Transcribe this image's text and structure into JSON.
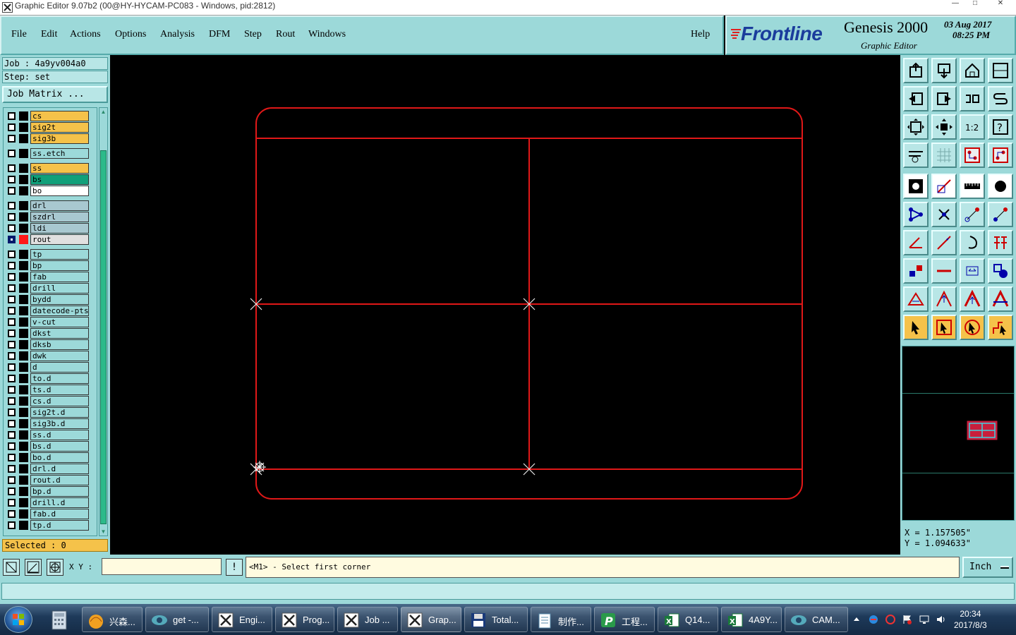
{
  "window": {
    "title": "Graphic Editor 9.07b2 (00@HY-HYCAM-PC083 - Windows, pid:2812)",
    "controls": [
      "—",
      "□",
      "✕"
    ]
  },
  "menu": [
    {
      "label": "File",
      "name": "menu-file"
    },
    {
      "label": "Edit",
      "name": "menu-edit"
    },
    {
      "label": "Actions",
      "name": "menu-actions"
    },
    {
      "label": "Options",
      "name": "menu-options"
    },
    {
      "label": "Analysis",
      "name": "menu-analysis"
    },
    {
      "label": "DFM",
      "name": "menu-dfm"
    },
    {
      "label": "Step",
      "name": "menu-step"
    },
    {
      "label": "Rout",
      "name": "menu-rout"
    },
    {
      "label": "Windows",
      "name": "menu-windows"
    },
    {
      "label": "Help",
      "name": "menu-help"
    }
  ],
  "logo": {
    "brand": "Frontline",
    "product": "Genesis 2000",
    "subtitle": "Graphic Editor",
    "date": "03 Aug 2017",
    "time": "08:25 PM"
  },
  "job": {
    "job_label": "Job : 4a9yv004a0",
    "step_label": "Step: set",
    "matrix_button": "Job Matrix ..."
  },
  "layers": [
    {
      "name": "cs",
      "bg": "#f5c24a",
      "active": false
    },
    {
      "name": "sig2t",
      "bg": "#f5c24a",
      "active": false
    },
    {
      "name": "sig3b",
      "bg": "#f5c24a",
      "active": false
    },
    {
      "name": "ss.etch",
      "bg": "#9cd9d9",
      "active": false,
      "gap": true
    },
    {
      "name": "ss",
      "bg": "#f5c24a",
      "active": false,
      "gap": true
    },
    {
      "name": "bs",
      "bg": "#11a07a",
      "active": false
    },
    {
      "name": "bo",
      "bg": "#ffffff",
      "active": false
    },
    {
      "name": "drl",
      "bg": "#a8c8d0",
      "active": false,
      "gap": true
    },
    {
      "name": "szdrl",
      "bg": "#a8c8d0",
      "active": false
    },
    {
      "name": "ldi",
      "bg": "#a8c8d0",
      "active": false
    },
    {
      "name": "rout",
      "bg": "#e0e0e0",
      "active": true,
      "color": "#ff1a1a"
    },
    {
      "name": "tp",
      "bg": "#9cd9d9",
      "active": false,
      "gap": true
    },
    {
      "name": "bp",
      "bg": "#9cd9d9",
      "active": false
    },
    {
      "name": "fab",
      "bg": "#9cd9d9",
      "active": false
    },
    {
      "name": "drill",
      "bg": "#9cd9d9",
      "active": false
    },
    {
      "name": "bydd",
      "bg": "#9cd9d9",
      "active": false
    },
    {
      "name": "datecode-pts",
      "bg": "#9cd9d9",
      "active": false
    },
    {
      "name": "v-cut",
      "bg": "#9cd9d9",
      "active": false
    },
    {
      "name": "dkst",
      "bg": "#9cd9d9",
      "active": false
    },
    {
      "name": "dksb",
      "bg": "#9cd9d9",
      "active": false
    },
    {
      "name": "dwk",
      "bg": "#9cd9d9",
      "active": false
    },
    {
      "name": "d",
      "bg": "#9cd9d9",
      "active": false
    },
    {
      "name": "to.d",
      "bg": "#9cd9d9",
      "active": false
    },
    {
      "name": "ts.d",
      "bg": "#9cd9d9",
      "active": false
    },
    {
      "name": "cs.d",
      "bg": "#9cd9d9",
      "active": false
    },
    {
      "name": "sig2t.d",
      "bg": "#9cd9d9",
      "active": false
    },
    {
      "name": "sig3b.d",
      "bg": "#9cd9d9",
      "active": false
    },
    {
      "name": "ss.d",
      "bg": "#9cd9d9",
      "active": false
    },
    {
      "name": "bs.d",
      "bg": "#9cd9d9",
      "active": false
    },
    {
      "name": "bo.d",
      "bg": "#9cd9d9",
      "active": false
    },
    {
      "name": "drl.d",
      "bg": "#9cd9d9",
      "active": false
    },
    {
      "name": "rout.d",
      "bg": "#9cd9d9",
      "active": false
    },
    {
      "name": "bp.d",
      "bg": "#9cd9d9",
      "active": false
    },
    {
      "name": "drill.d",
      "bg": "#9cd9d9",
      "active": false
    },
    {
      "name": "fab.d",
      "bg": "#9cd9d9",
      "active": false
    },
    {
      "name": "tp.d",
      "bg": "#9cd9d9",
      "active": false
    }
  ],
  "selected": "Selected : 0",
  "coords": {
    "x": "X = 1.157505\"",
    "y": "Y = 1.094633\""
  },
  "command": {
    "xy_label": "X Y :",
    "xy_value": "",
    "bang_label": "!",
    "prompt": "<M1> - Select first corner",
    "units": "Inch"
  },
  "colors": {
    "accent": "#9cd9d9",
    "rout_line": "#e01818",
    "highlight": "#f5c24a"
  },
  "taskbar": {
    "tasks": [
      {
        "label": "兴森...",
        "icon": "shell-icon"
      },
      {
        "label": "get -...",
        "icon": "eye-icon"
      },
      {
        "label": "Engi...",
        "icon": "genesis-icon"
      },
      {
        "label": "Prog...",
        "icon": "genesis-icon"
      },
      {
        "label": "Job ...",
        "icon": "genesis-icon"
      },
      {
        "label": "Grap...",
        "icon": "genesis-icon"
      },
      {
        "label": "Total...",
        "icon": "floppy-icon"
      },
      {
        "label": "制作...",
        "icon": "notepad-icon"
      },
      {
        "label": "工程...",
        "icon": "p-icon"
      },
      {
        "label": "Q14...",
        "icon": "excel-icon"
      },
      {
        "label": "4A9Y...",
        "icon": "excel-icon"
      },
      {
        "label": "CAM...",
        "icon": "eye-icon"
      }
    ],
    "clock_time": "20:34",
    "clock_date": "2017/8/3"
  }
}
